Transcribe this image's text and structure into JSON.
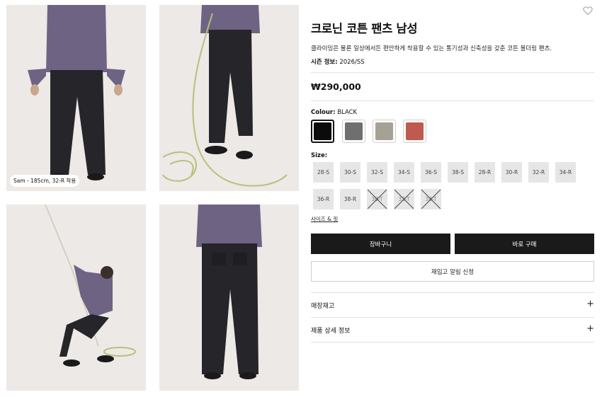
{
  "gallery": {
    "caption": "Sam - 185cm, 32-R 착용"
  },
  "product": {
    "title": "크로닌 코튼 팬츠 남성",
    "description": "클라이밍은 물론 일상에서든 편안하게 착용할 수 있는 통기성과 신축성을 갖춘 코튼 볼더링 팬츠.",
    "season_label": "시즌 정보:",
    "season_value": "2026/SS",
    "price": "₩290,000"
  },
  "colour": {
    "label": "Colour:",
    "selected": "BLACK",
    "swatches": [
      {
        "name": "BLACK",
        "color": "#0b0b0b",
        "selected": true
      },
      {
        "name": "GREY",
        "color": "#6f6f70",
        "selected": false
      },
      {
        "name": "KHAKI",
        "color": "#a5a194",
        "selected": false
      },
      {
        "name": "RED",
        "color": "#be5a4f",
        "selected": false
      }
    ]
  },
  "size": {
    "label": "Size:",
    "options": [
      "28-S",
      "30-S",
      "32-S",
      "34-S",
      "36-S",
      "38-S",
      "28-R",
      "30-R",
      "32-R",
      "34-R",
      "36-R",
      "38-R",
      "30-T",
      "32-T",
      "34-T"
    ],
    "sold_out": [
      "30-T",
      "32-T",
      "34-T"
    ],
    "guide_link": "사이즈 & 핏"
  },
  "actions": {
    "cart": "장바구니",
    "buy_now": "바로 구매",
    "restock": "재입고 알림 신청"
  },
  "accordion": {
    "stock": "매장재고",
    "details": "제품 상세 정보",
    "expand_symbol": "+"
  }
}
